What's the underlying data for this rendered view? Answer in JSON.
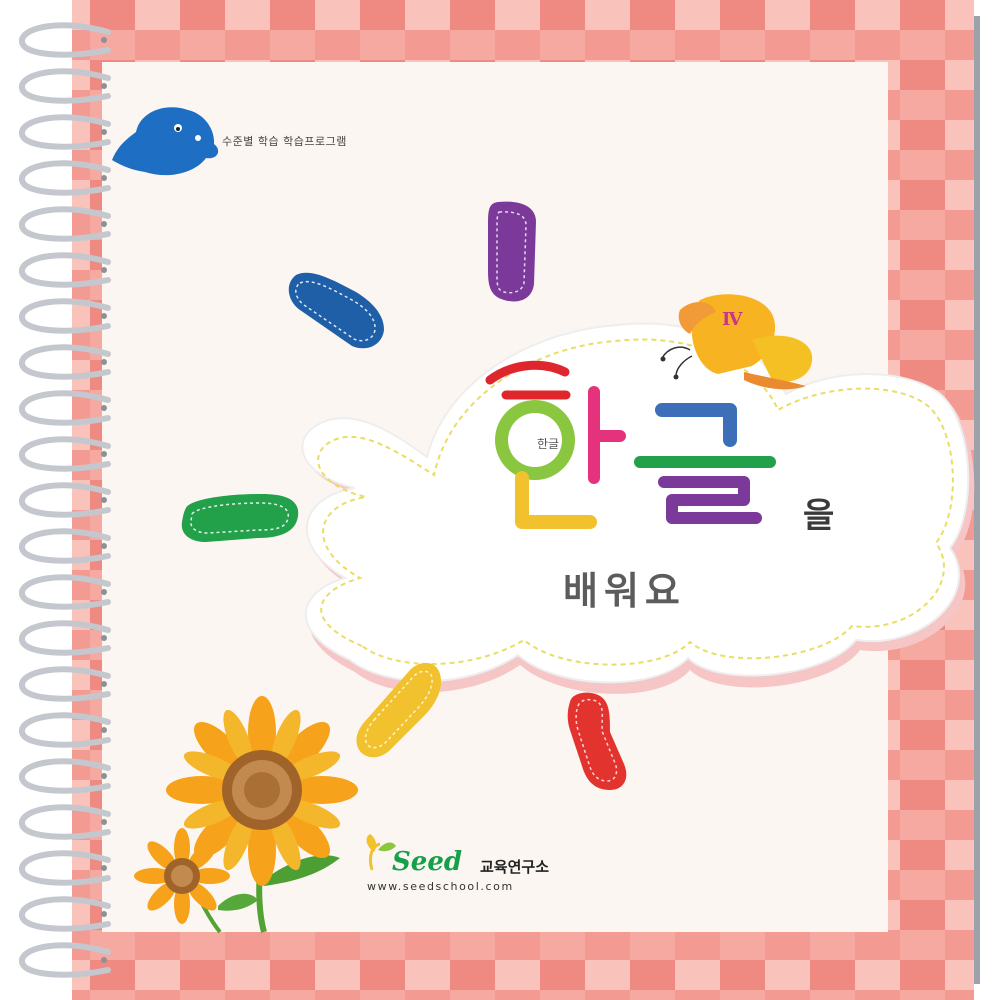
{
  "cover": {
    "tagline": "수준별 학습 학습프로그램",
    "volume": "Ⅳ",
    "title_glyphs": [
      "한",
      "글"
    ],
    "title_inner_mark": "한글",
    "title_particle": "을",
    "subtitle": "배워요",
    "publisher": {
      "brand": "Seed",
      "suffix": "교육연구소",
      "website": "www.seedschool.com"
    }
  },
  "colors": {
    "check_light": "#f7b2aa",
    "check_dark": "#ef8a83",
    "page": "#fbf6f1",
    "spiral": "#bfc3c9",
    "bird": "#1e6fc4",
    "stroke_blue": "#1e5fa8",
    "stroke_purple": "#7b3a9a",
    "stroke_green": "#22a04a",
    "stroke_yellow": "#f2c12e",
    "stroke_red": "#e2332f",
    "sunflower_petal": "#f7a21b",
    "sunflower_center": "#a0642a",
    "butterfly": "#f7b321"
  },
  "icons": {
    "bird": "blue-bird-icon",
    "butterfly": "butterfly-icon",
    "sunflower": "sunflower-icon",
    "seed_logo": "sprout-icon"
  }
}
